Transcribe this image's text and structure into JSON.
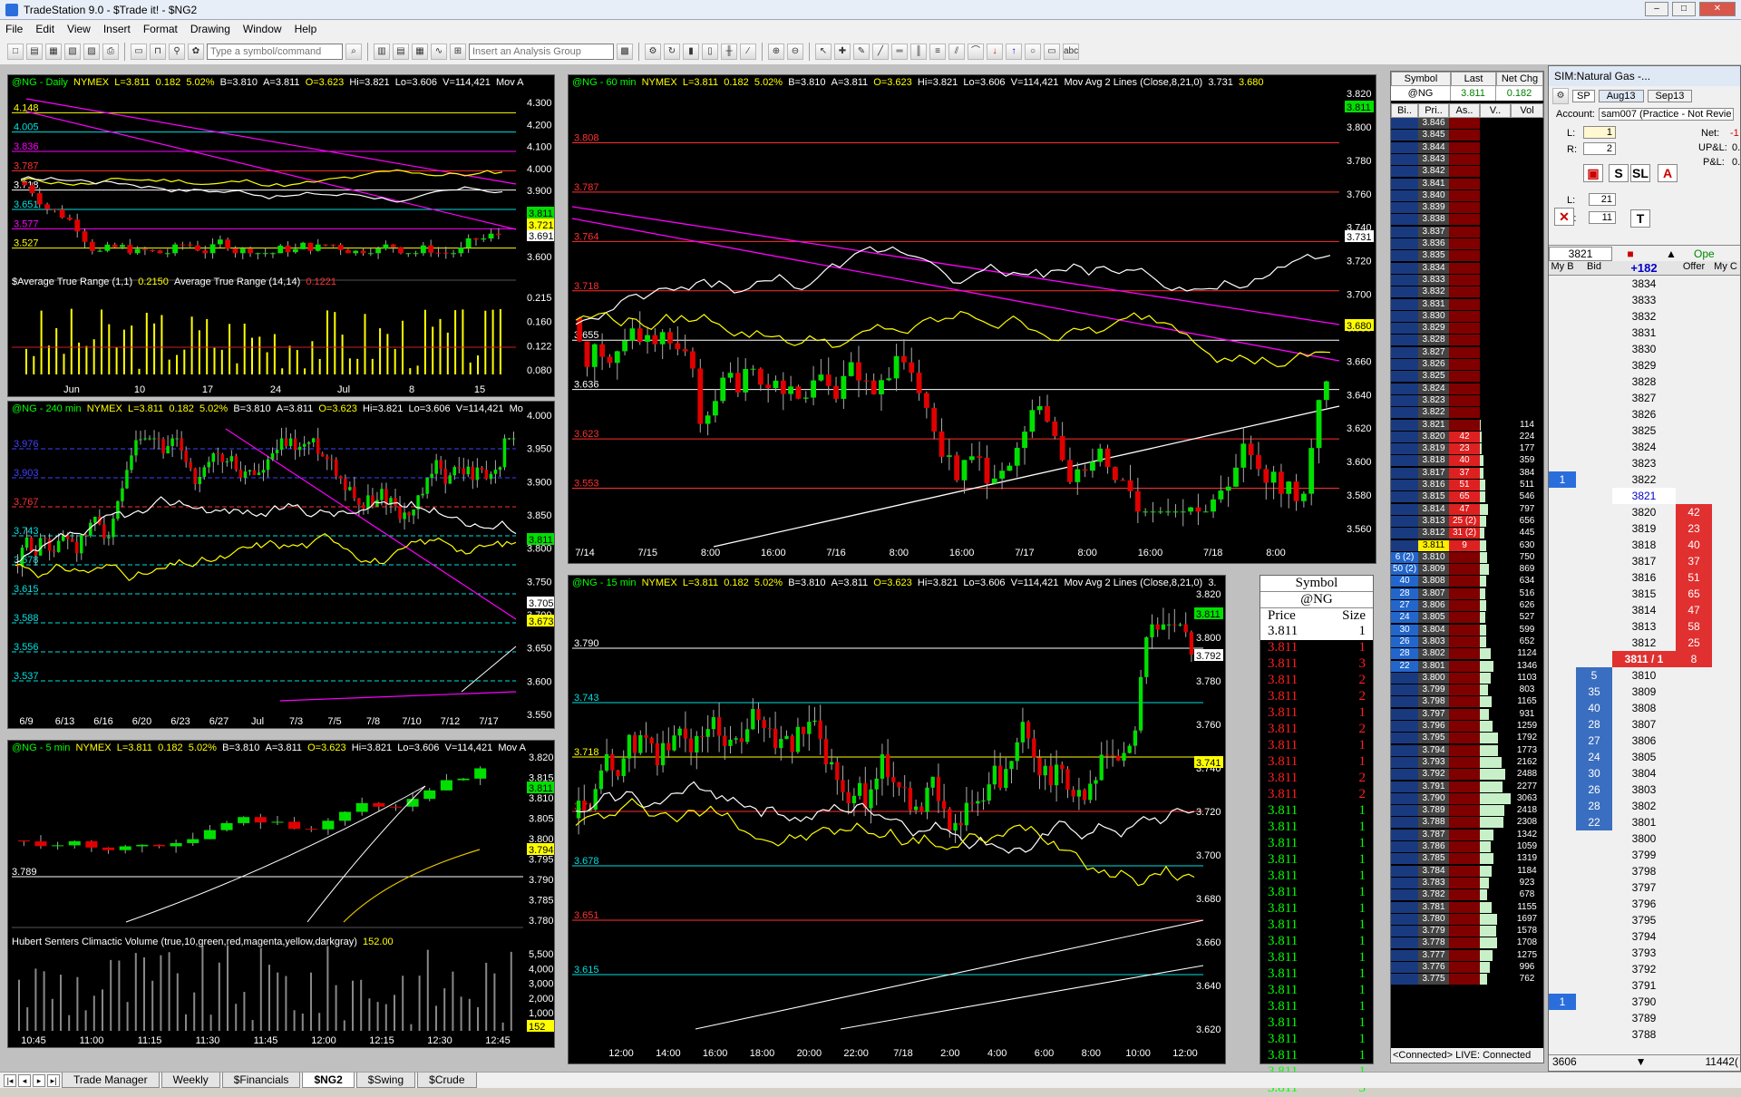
{
  "window": {
    "title": "TradeStation 9.0 - $Trade it! - $NG2"
  },
  "menu": [
    "File",
    "Edit",
    "View",
    "Insert",
    "Format",
    "Drawing",
    "Window",
    "Help"
  ],
  "toolbar": {
    "symbol_placeholder": "Type a symbol/command",
    "analysis_placeholder": "Insert an Analysis Group"
  },
  "charts": {
    "daily": {
      "symbol": "@NG - Daily",
      "exchange": "NYMEX",
      "last": "L=3.811",
      "chg": "0.182",
      "pct": "5.02%",
      "bid": "B=3.810",
      "ask": "A=3.811",
      "open": "O=3.623",
      "high": "Hi=3.821",
      "low": "Lo=3.606",
      "vol": "V=114,421",
      "study": "Mov A",
      "atr_label": "$Average True Range (1,1)",
      "atr_val": "0.2150",
      "atr2_label": "Average True Range (14,14)",
      "atr2_val": "0.1221",
      "y_ticks": [
        "4.300",
        "4.200",
        "4.100",
        "4.000",
        "3.900",
        "3.800",
        "3.700",
        "3.600"
      ],
      "atr_ticks": [
        "0.215",
        "0.160",
        "0.122",
        "0.080"
      ],
      "x_ticks": [
        "Jun",
        "10",
        "17",
        "24",
        "Jul",
        "8",
        "15"
      ],
      "price_tag": "3.811",
      "tag2": "3.691",
      "tag3": "3.721",
      "levels": [
        "4.148",
        "4.005",
        "3.836",
        "3.787",
        "3.718",
        "3.651",
        "3.577",
        "3.527"
      ]
    },
    "m240": {
      "symbol": "@NG - 240 min",
      "exchange": "NYMEX",
      "last": "L=3.811",
      "chg": "0.182",
      "pct": "5.02%",
      "bid": "B=3.810",
      "ask": "A=3.811",
      "open": "O=3.623",
      "high": "Hi=3.821",
      "low": "Lo=3.606",
      "vol": "V=114,421",
      "study": "Mo",
      "y_ticks": [
        "4.000",
        "3.950",
        "3.900",
        "3.850",
        "3.800",
        "3.750",
        "3.700",
        "3.650",
        "3.600",
        "3.550"
      ],
      "x_ticks": [
        "6/9",
        "6/13",
        "6/16",
        "6/20",
        "6/23",
        "6/27",
        "Jul",
        "7/3",
        "7/5",
        "7/8",
        "7/10",
        "7/12",
        "7/17"
      ],
      "price_tag": "3.811",
      "tag2": "3.705",
      "tag3": "3.673",
      "levels": [
        "3.976",
        "3.903",
        "3.767",
        "3.743",
        "3.678",
        "3.615",
        "3.588",
        "3.556",
        "3.537"
      ]
    },
    "m5": {
      "symbol": "@NG - 5 min",
      "exchange": "NYMEX",
      "last": "L=3.811",
      "chg": "0.182",
      "pct": "5.02%",
      "bid": "B=3.810",
      "ask": "A=3.811",
      "open": "O=3.623",
      "high": "Hi=3.821",
      "low": "Lo=3.606",
      "vol": "V=114,421",
      "study": "Mov A",
      "vol_label": "Hubert Senters Climactic Volume (true,10,green,red,magenta,yellow,darkgray)",
      "vol_val": "152.00",
      "y_ticks": [
        "3.820",
        "3.815",
        "3.810",
        "3.805",
        "3.800",
        "3.795",
        "3.790",
        "3.785",
        "3.780"
      ],
      "vol_ticks": [
        "5,500",
        "4,000",
        "3,000",
        "2,000",
        "1,000"
      ],
      "vol_tag": "152",
      "x_ticks": [
        "10:45",
        "11:00",
        "11:15",
        "11:30",
        "11:45",
        "12:00",
        "12:15",
        "12:30",
        "12:45"
      ],
      "price_tag": "3.811",
      "tag2": "3.794",
      "level": "3.789"
    },
    "m60": {
      "symbol": "@NG - 60 min",
      "exchange": "NYMEX",
      "last": "L=3.811",
      "chg": "0.182",
      "pct": "5.02%",
      "bid": "B=3.810",
      "ask": "A=3.811",
      "open": "O=3.623",
      "high": "Hi=3.821",
      "low": "Lo=3.606",
      "vol": "V=114,421",
      "study": "Mov Avg 2 Lines (Close,8,21,0)",
      "ma1": "3.731",
      "ma2": "3.680",
      "y_ticks": [
        "3.820",
        "3.800",
        "3.780",
        "3.760",
        "3.740",
        "3.720",
        "3.700",
        "3.680",
        "3.660",
        "3.640",
        "3.620",
        "3.600",
        "3.580",
        "3.560"
      ],
      "x_ticks": [
        "7/14",
        "7/15",
        "8:00",
        "16:00",
        "7/16",
        "8:00",
        "16:00",
        "7/17",
        "8:00",
        "16:00",
        "7/18",
        "8:00"
      ],
      "price_tag": "3.811",
      "tag2": "3.731",
      "tag3": "3.680",
      "levels": [
        "3.808",
        "3.787",
        "3.764",
        "3.718",
        "3.655",
        "3.636",
        "3.623",
        "3.553"
      ]
    },
    "m15": {
      "symbol": "@NG - 15 min",
      "exchange": "NYMEX",
      "last": "L=3.811",
      "chg": "0.182",
      "pct": "5.02%",
      "bid": "B=3.810",
      "ask": "A=3.811",
      "open": "O=3.623",
      "high": "Hi=3.821",
      "low": "Lo=3.606",
      "vol": "V=114,421",
      "study": "Mov Avg 2 Lines (Close,8,21,0)",
      "ma1": "3.",
      "y_ticks": [
        "3.820",
        "3.800",
        "3.780",
        "3.760",
        "3.740",
        "3.720",
        "3.700",
        "3.680",
        "3.660",
        "3.640",
        "3.620"
      ],
      "x_ticks": [
        "12:00",
        "14:00",
        "16:00",
        "18:00",
        "20:00",
        "22:00",
        "7/18",
        "2:00",
        "4:00",
        "6:00",
        "8:00",
        "10:00",
        "12:00"
      ],
      "price_tag": "3.811",
      "tag2": "3.792",
      "tag3": "3.741",
      "levels": [
        "3.790",
        "3.743",
        "3.718",
        "3.711",
        "3.678",
        "3.651",
        "3.615"
      ]
    }
  },
  "time_sales": {
    "symbol_label": "Symbol",
    "symbol": "@NG",
    "col_price": "Price",
    "col_size": "Size",
    "rows": [
      {
        "price": "3.811",
        "size": "1",
        "color": "#fff"
      },
      {
        "price": "3.811",
        "size": "1",
        "color": "#ff2020"
      },
      {
        "price": "3.811",
        "size": "3",
        "color": "#ff2020"
      },
      {
        "price": "3.811",
        "size": "2",
        "color": "#ff2020"
      },
      {
        "price": "3.811",
        "size": "2",
        "color": "#ff2020"
      },
      {
        "price": "3.811",
        "size": "1",
        "color": "#ff2020"
      },
      {
        "price": "3.811",
        "size": "2",
        "color": "#ff2020"
      },
      {
        "price": "3.811",
        "size": "1",
        "color": "#ff2020"
      },
      {
        "price": "3.811",
        "size": "1",
        "color": "#ff2020"
      },
      {
        "price": "3.811",
        "size": "2",
        "color": "#ff2020"
      },
      {
        "price": "3.811",
        "size": "2",
        "color": "#ff2020"
      },
      {
        "price": "3.811",
        "size": "1",
        "color": "#00ff00"
      },
      {
        "price": "3.811",
        "size": "1",
        "color": "#00ff00"
      },
      {
        "price": "3.811",
        "size": "1",
        "color": "#00ff00"
      },
      {
        "price": "3.811",
        "size": "1",
        "color": "#00ff00"
      },
      {
        "price": "3.811",
        "size": "1",
        "color": "#00ff00"
      },
      {
        "price": "3.811",
        "size": "1",
        "color": "#00ff00"
      },
      {
        "price": "3.811",
        "size": "1",
        "color": "#00ff00"
      },
      {
        "price": "3.811",
        "size": "1",
        "color": "#00ff00"
      },
      {
        "price": "3.811",
        "size": "1",
        "color": "#00ff00"
      },
      {
        "price": "3.811",
        "size": "1",
        "color": "#00ff00"
      },
      {
        "price": "3.811",
        "size": "1",
        "color": "#00ff00"
      },
      {
        "price": "3.811",
        "size": "1",
        "color": "#00ff00"
      },
      {
        "price": "3.811",
        "size": "1",
        "color": "#00ff00"
      },
      {
        "price": "3.811",
        "size": "1",
        "color": "#00ff00"
      },
      {
        "price": "3.811",
        "size": "1",
        "color": "#00ff00"
      },
      {
        "price": "3.811",
        "size": "1",
        "color": "#00ff00"
      },
      {
        "price": "3.811",
        "size": "1",
        "color": "#00ff00"
      },
      {
        "price": "3.811",
        "size": "3",
        "color": "#00ff00"
      }
    ]
  },
  "radar": {
    "headers": [
      "Symbol",
      "Last",
      "Net Chg"
    ],
    "row": {
      "symbol": "@NG",
      "last": "3.811",
      "net": "0.182"
    },
    "dom_headers": [
      "Bi..",
      "Pri..",
      "As..",
      "V..",
      "Vol"
    ],
    "status": "<Connected> LIVE: Connected",
    "ladder": [
      {
        "p": "3.846",
        "a": "",
        "v": ""
      },
      {
        "p": "3.845",
        "a": "",
        "v": ""
      },
      {
        "p": "3.844",
        "a": "",
        "v": ""
      },
      {
        "p": "3.843",
        "a": "",
        "v": ""
      },
      {
        "p": "3.842",
        "a": "",
        "v": ""
      },
      {
        "p": "3.841",
        "a": "",
        "v": ""
      },
      {
        "p": "3.840",
        "a": "",
        "v": ""
      },
      {
        "p": "3.839",
        "a": "",
        "v": ""
      },
      {
        "p": "3.838",
        "a": "",
        "v": ""
      },
      {
        "p": "3.837",
        "a": "",
        "v": ""
      },
      {
        "p": "3.836",
        "a": "",
        "v": ""
      },
      {
        "p": "3.835",
        "a": "",
        "v": ""
      },
      {
        "p": "3.834",
        "a": "",
        "v": ""
      },
      {
        "p": "3.833",
        "a": "",
        "v": ""
      },
      {
        "p": "3.832",
        "a": "",
        "v": ""
      },
      {
        "p": "3.831",
        "a": "",
        "v": ""
      },
      {
        "p": "3.830",
        "a": "",
        "v": ""
      },
      {
        "p": "3.829",
        "a": "",
        "v": ""
      },
      {
        "p": "3.828",
        "a": "",
        "v": ""
      },
      {
        "p": "3.827",
        "a": "",
        "v": ""
      },
      {
        "p": "3.826",
        "a": "",
        "v": ""
      },
      {
        "p": "3.825",
        "a": "",
        "v": ""
      },
      {
        "p": "3.824",
        "a": "",
        "v": ""
      },
      {
        "p": "3.823",
        "a": "",
        "v": ""
      },
      {
        "p": "3.822",
        "a": "",
        "v": ""
      },
      {
        "p": "3.821",
        "a": "",
        "v": "114"
      },
      {
        "p": "3.820",
        "a": "42",
        "v": "224"
      },
      {
        "p": "3.819",
        "a": "23",
        "v": "177"
      },
      {
        "p": "3.818",
        "a": "40",
        "v": "359"
      },
      {
        "p": "3.817",
        "a": "37",
        "v": "384"
      },
      {
        "p": "3.816",
        "a": "51",
        "v": "511"
      },
      {
        "p": "3.815",
        "a": "65",
        "v": "546"
      },
      {
        "p": "3.814",
        "a": "47",
        "v": "797"
      },
      {
        "p": "3.813",
        "a": "25 (2)",
        "v": "656"
      },
      {
        "p": "3.812",
        "a": "31 (2)",
        "v": "445"
      },
      {
        "p": "3.811",
        "a": "9",
        "v": "630"
      },
      {
        "p": "3.810",
        "a": "",
        "v": "750",
        "b": "6 (2)"
      },
      {
        "p": "3.809",
        "a": "",
        "v": "869",
        "b": "50 (2)"
      },
      {
        "p": "3.808",
        "a": "",
        "v": "634",
        "b": "40"
      },
      {
        "p": "3.807",
        "a": "",
        "v": "516",
        "b": "28"
      },
      {
        "p": "3.806",
        "a": "",
        "v": "626",
        "b": "27"
      },
      {
        "p": "3.805",
        "a": "",
        "v": "527",
        "b": "24"
      },
      {
        "p": "3.804",
        "a": "",
        "v": "599",
        "b": "30"
      },
      {
        "p": "3.803",
        "a": "",
        "v": "652",
        "b": "26"
      },
      {
        "p": "3.802",
        "a": "",
        "v": "1124",
        "b": "28"
      },
      {
        "p": "3.801",
        "a": "",
        "v": "1346",
        "b": "22"
      },
      {
        "p": "3.800",
        "a": "",
        "v": "1103"
      },
      {
        "p": "3.799",
        "a": "",
        "v": "803"
      },
      {
        "p": "3.798",
        "a": "",
        "v": "1165"
      },
      {
        "p": "3.797",
        "a": "",
        "v": "931"
      },
      {
        "p": "3.796",
        "a": "",
        "v": "1259"
      },
      {
        "p": "3.795",
        "a": "",
        "v": "1792"
      },
      {
        "p": "3.794",
        "a": "",
        "v": "1773"
      },
      {
        "p": "3.793",
        "a": "",
        "v": "2162"
      },
      {
        "p": "3.792",
        "a": "",
        "v": "2488"
      },
      {
        "p": "3.791",
        "a": "",
        "v": "2277"
      },
      {
        "p": "3.790",
        "a": "",
        "v": "3063"
      },
      {
        "p": "3.789",
        "a": "",
        "v": "2418"
      },
      {
        "p": "3.788",
        "a": "",
        "v": "2308"
      },
      {
        "p": "3.787",
        "a": "",
        "v": "1342"
      },
      {
        "p": "3.786",
        "a": "",
        "v": "1059"
      },
      {
        "p": "3.785",
        "a": "",
        "v": "1319"
      },
      {
        "p": "3.784",
        "a": "",
        "v": "1184"
      },
      {
        "p": "3.783",
        "a": "",
        "v": "923"
      },
      {
        "p": "3.782",
        "a": "",
        "v": "678"
      },
      {
        "p": "3.781",
        "a": "",
        "v": "1155"
      },
      {
        "p": "3.780",
        "a": "",
        "v": "1697"
      },
      {
        "p": "3.779",
        "a": "",
        "v": "1578"
      },
      {
        "p": "3.778",
        "a": "",
        "v": "1708"
      },
      {
        "p": "3.777",
        "a": "",
        "v": "1275"
      },
      {
        "p": "3.776",
        "a": "",
        "v": "996"
      },
      {
        "p": "3.775",
        "a": "",
        "v": "762"
      }
    ]
  },
  "matrix": {
    "title": "SIM:Natural Gas -...",
    "route": "SP",
    "months": [
      "Aug13",
      "Sep13"
    ],
    "account_label": "Account:",
    "account": "sam007 (Practice - Not Revie",
    "net_label": "Net:",
    "net": "-1",
    "upl_label": "UP&L:",
    "upl": "0.",
    "pl_label": "P&L:",
    "pl": "0.",
    "l_label": "L:",
    "l_val": "1",
    "r_label": "R:",
    "r_val": "2",
    "l2_label": "L:",
    "l2_val": "21",
    "s_label": "S:",
    "s_val": "11",
    "price_box": "3821",
    "open_label": "Ope",
    "cols": [
      "My B",
      "Bid",
      "+182",
      "Offer",
      "My C"
    ],
    "footer_left": "3606",
    "footer_right": "11442(",
    "rows": [
      {
        "p": "3834"
      },
      {
        "p": "3833"
      },
      {
        "p": "3832"
      },
      {
        "p": "3831"
      },
      {
        "p": "3830"
      },
      {
        "p": "3829"
      },
      {
        "p": "3828"
      },
      {
        "p": "3827"
      },
      {
        "p": "3826"
      },
      {
        "p": "3825"
      },
      {
        "p": "3824"
      },
      {
        "p": "3823"
      },
      {
        "p": "3822",
        "mb": "1"
      },
      {
        "p": "3821",
        "hi": true
      },
      {
        "p": "3820",
        "o": "42"
      },
      {
        "p": "3819",
        "o": "23"
      },
      {
        "p": "3818",
        "o": "40"
      },
      {
        "p": "3817",
        "o": "37"
      },
      {
        "p": "3816",
        "o": "51"
      },
      {
        "p": "3815",
        "o": "65"
      },
      {
        "p": "3814",
        "o": "47"
      },
      {
        "p": "3813",
        "o": "58"
      },
      {
        "p": "3812",
        "o": "25"
      },
      {
        "p": "3811 / 1",
        "o": "8",
        "last": true
      },
      {
        "p": "3810",
        "b": "5"
      },
      {
        "p": "3809",
        "b": "35"
      },
      {
        "p": "3808",
        "b": "40"
      },
      {
        "p": "3807",
        "b": "28"
      },
      {
        "p": "3806",
        "b": "27"
      },
      {
        "p": "3805",
        "b": "24"
      },
      {
        "p": "3804",
        "b": "30"
      },
      {
        "p": "3803",
        "b": "26"
      },
      {
        "p": "3802",
        "b": "28"
      },
      {
        "p": "3801",
        "b": "22"
      },
      {
        "p": "3800"
      },
      {
        "p": "3799"
      },
      {
        "p": "3798"
      },
      {
        "p": "3797"
      },
      {
        "p": "3796"
      },
      {
        "p": "3795"
      },
      {
        "p": "3794"
      },
      {
        "p": "3793"
      },
      {
        "p": "3792"
      },
      {
        "p": "3791"
      },
      {
        "p": "3790",
        "mb": "1"
      },
      {
        "p": "3789"
      },
      {
        "p": "3788"
      }
    ]
  },
  "tabs": [
    "Trade Manager",
    "Weekly",
    "$Financials",
    "$NG2",
    "$Swing",
    "$Crude"
  ],
  "active_tab": "$NG2"
}
